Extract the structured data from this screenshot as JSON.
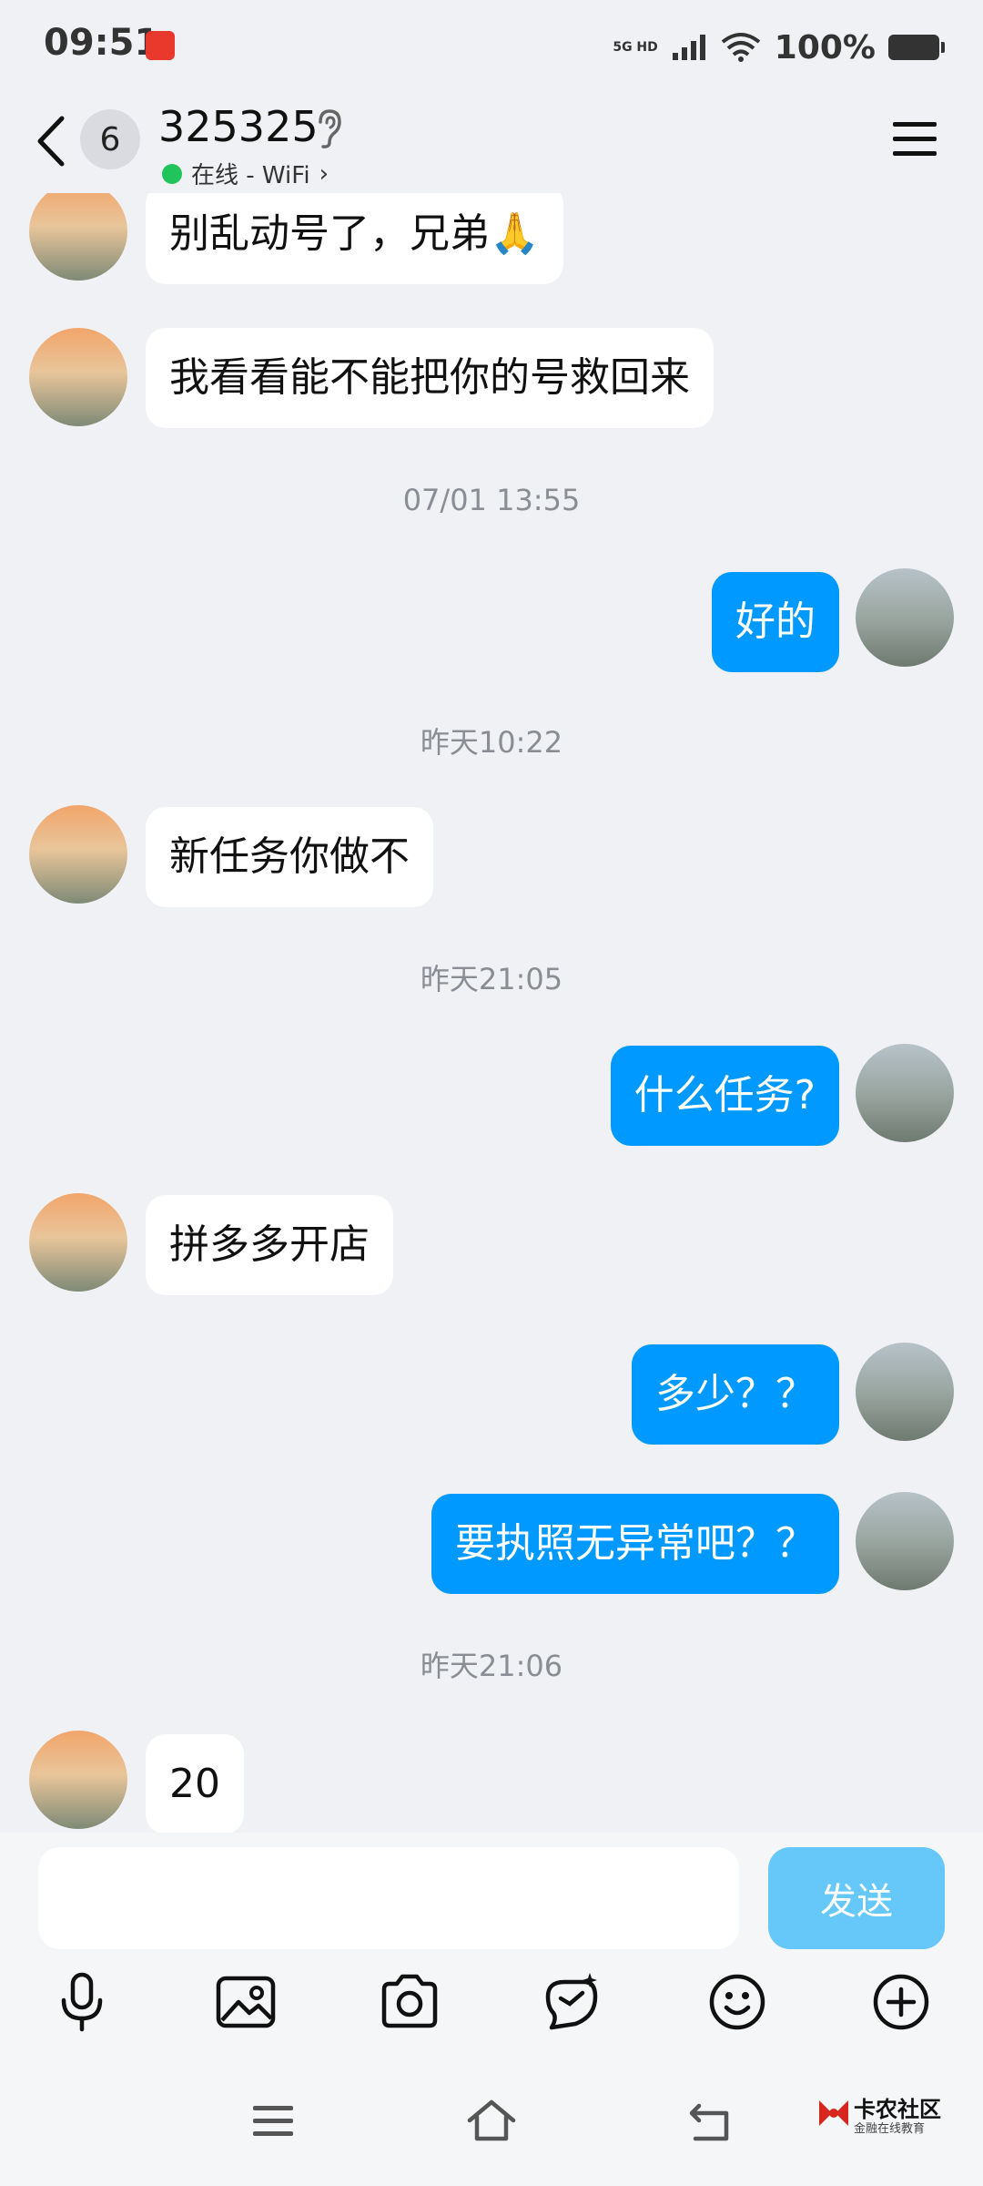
{
  "status": {
    "time": "09:51",
    "network": "5G HD",
    "battery": "100%"
  },
  "header": {
    "unread_count": "6",
    "title": "325325",
    "online_text": "在线 - WiFi",
    "chevron": "›"
  },
  "messages": [
    {
      "side": "left",
      "text": "别乱动号了，兄弟🙏"
    },
    {
      "side": "left",
      "text": "我看看能不能把你的号救回来"
    },
    {
      "type": "time",
      "text": "07/01 13:55"
    },
    {
      "side": "right",
      "text": "好的"
    },
    {
      "type": "time",
      "text": "昨天10:22"
    },
    {
      "side": "left",
      "text": "新任务你做不"
    },
    {
      "type": "time",
      "text": "昨天21:05"
    },
    {
      "side": "right",
      "text": "什么任务?"
    },
    {
      "side": "left",
      "text": "拼多多开店"
    },
    {
      "side": "right",
      "text": "多少？？"
    },
    {
      "side": "right",
      "text": "要执照无异常吧？？"
    },
    {
      "type": "time",
      "text": "昨天21:06"
    },
    {
      "side": "left",
      "text": "20"
    }
  ],
  "input": {
    "placeholder": "",
    "send_label": "发送"
  },
  "toolbar_icons": [
    "microphone-icon",
    "image-icon",
    "camera-icon",
    "red-packet-icon",
    "emoji-icon",
    "plus-icon"
  ],
  "watermark": {
    "title": "卡农社区",
    "subtitle": "金融在线教育"
  },
  "colors": {
    "accent": "#0099ff",
    "send_disabled": "#65c8f8",
    "online": "#21c45b",
    "background": "#f0f1f5"
  }
}
